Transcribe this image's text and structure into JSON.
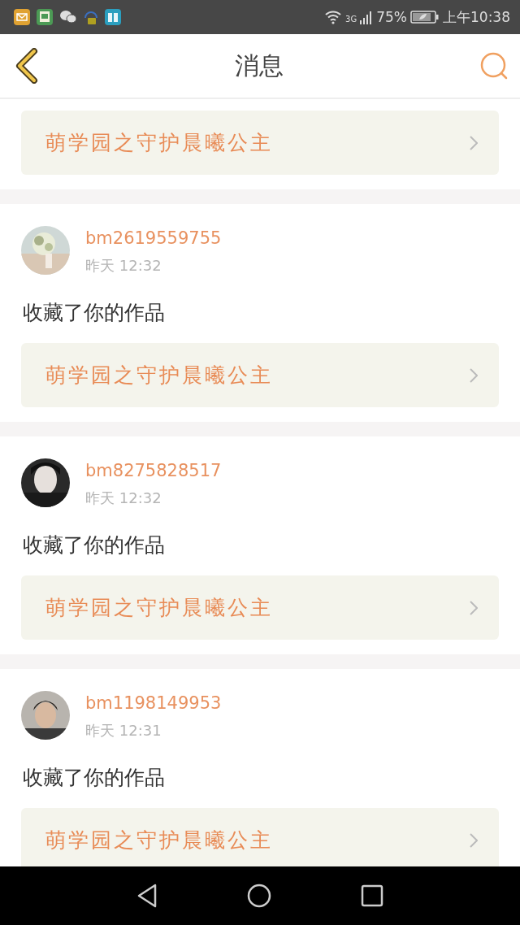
{
  "status_bar": {
    "network": "3G",
    "battery": "75%",
    "time": "上午10:38"
  },
  "header": {
    "title": "消息"
  },
  "top_card": {
    "work_title": "萌学园之守护晨曦公主"
  },
  "notifications": [
    {
      "user": "bm2619559755",
      "time": "昨天 12:32",
      "action": "收藏了你的作品",
      "work_title": "萌学园之守护晨曦公主"
    },
    {
      "user": "bm8275828517",
      "time": "昨天 12:32",
      "action": "收藏了你的作品",
      "work_title": "萌学园之守护晨曦公主"
    },
    {
      "user": "bm1198149953",
      "time": "昨天 12:31",
      "action": "收藏了你的作品",
      "work_title": "萌学园之守护晨曦公主"
    }
  ]
}
